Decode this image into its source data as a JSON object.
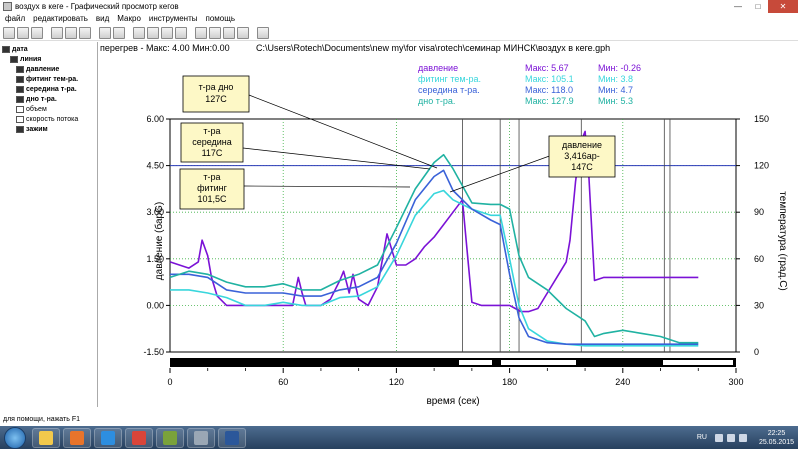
{
  "window": {
    "title": "воздух в кеге - Графический просмотр кегов"
  },
  "menu": [
    "файл",
    "редактировать",
    "вид",
    "Макро",
    "инструменты",
    "помощь"
  ],
  "tree": {
    "items": [
      {
        "label": "дата",
        "bold": true,
        "level": 0
      },
      {
        "label": "линия",
        "bold": true,
        "level": 1
      },
      {
        "label": "давление",
        "bold": true,
        "level": 2
      },
      {
        "label": "фитинг тем-ра.",
        "bold": true,
        "level": 2
      },
      {
        "label": "середина т-ра.",
        "bold": true,
        "level": 2
      },
      {
        "label": "дно т-ра.",
        "bold": true,
        "level": 2
      },
      {
        "label": "объем",
        "bold": false,
        "level": 2
      },
      {
        "label": "скорость потока",
        "bold": false,
        "level": 2
      },
      {
        "label": "зажим",
        "bold": true,
        "level": 2
      }
    ]
  },
  "header": {
    "info": "перегрев - Макс: 4.00  Мин:0.00",
    "path": "C:\\Users\\Rotech\\Documents\\new my\\for visa\\rotech\\семинар МИНСК\\воздух в кеге.gph"
  },
  "legend": [
    {
      "name": "давление",
      "max": "Макс: 5.67",
      "min": "Мин: -0.26",
      "color": "#7b12d6"
    },
    {
      "name": "фитинг тем-ра.",
      "max": "Макс: 105.1",
      "min": "Мин: 3.8",
      "color": "#38d6dc"
    },
    {
      "name": "середина т-ра.",
      "max": "Макс: 118.0",
      "min": "Мин: 4.7",
      "color": "#3a62d8"
    },
    {
      "name": "дно т-ра.",
      "max": "Макс: 127.9",
      "min": "Мин: 5.3",
      "color": "#20b2a2"
    }
  ],
  "annotations": [
    {
      "lines": [
        "т-ра дно",
        "127C"
      ]
    },
    {
      "lines": [
        "т-ра",
        "середина",
        "117C"
      ]
    },
    {
      "lines": [
        "т-ра",
        "фитинг",
        "101,5C"
      ]
    },
    {
      "lines": [
        "давление",
        "3,416ар-",
        "147C"
      ]
    }
  ],
  "chart_data": {
    "type": "line",
    "xlabel": "время (сек)",
    "ylabel": "давление (барG)",
    "y2label": "температура (град.C)",
    "xlim": [
      0,
      300
    ],
    "ylim": [
      -1.5,
      6.0
    ],
    "y2lim": [
      0,
      150
    ],
    "x_ticks": [
      0,
      60,
      120,
      180,
      240,
      300
    ],
    "y_ticks": [
      "-1.50",
      "0.00",
      "1.50",
      "3.00",
      "4.50",
      "6.00"
    ],
    "y2_ticks": [
      0,
      30,
      60,
      90,
      120,
      150
    ],
    "reference_line_y": 4.5,
    "grid": true,
    "series": [
      {
        "name": "давление",
        "axis": "left",
        "color": "#7b12d6",
        "x": [
          0,
          5,
          10,
          15,
          17,
          20,
          22,
          25,
          30,
          35,
          40,
          45,
          50,
          55,
          60,
          65,
          68,
          70,
          72,
          75,
          80,
          85,
          90,
          92,
          95,
          97,
          100,
          105,
          110,
          115,
          120,
          122,
          125,
          130,
          135,
          140,
          145,
          150,
          155,
          160,
          165,
          170,
          175,
          180,
          183,
          186,
          190,
          195,
          200,
          205,
          210,
          212,
          215,
          218,
          220,
          222,
          225,
          230,
          240,
          250,
          260,
          270,
          280
        ],
        "values": [
          1.4,
          1.3,
          1.2,
          1.4,
          2.1,
          1.6,
          0.9,
          0.3,
          0.0,
          0.0,
          0.0,
          0.0,
          0.0,
          0.0,
          0.0,
          0.0,
          0.9,
          0.4,
          0.0,
          0.0,
          0.0,
          0.2,
          0.8,
          1.1,
          0.4,
          1.0,
          0.2,
          0.0,
          0.6,
          2.3,
          1.3,
          1.3,
          1.3,
          1.5,
          1.9,
          2.2,
          2.6,
          3.0,
          3.4,
          0.1,
          0.0,
          0.0,
          0.0,
          0.0,
          -0.1,
          -0.2,
          -0.2,
          -0.1,
          0.4,
          0.9,
          1.4,
          2.1,
          4.0,
          5.3,
          5.6,
          4.2,
          0.8,
          0.9,
          0.9,
          0.9,
          0.9,
          0.9,
          0.9
        ]
      },
      {
        "name": "фитинг тем-ра.",
        "axis": "right",
        "color": "#38d6dc",
        "x": [
          0,
          10,
          20,
          30,
          40,
          50,
          60,
          70,
          80,
          90,
          100,
          110,
          120,
          130,
          140,
          145,
          150,
          160,
          170,
          175,
          180,
          185,
          190,
          200,
          210,
          220,
          230,
          240,
          250,
          260,
          270,
          280
        ],
        "values": [
          40,
          40,
          38,
          35,
          30,
          30,
          32,
          30,
          30,
          35,
          36,
          42,
          62,
          88,
          102,
          104,
          98,
          92,
          88,
          88,
          60,
          30,
          15,
          7,
          5,
          4,
          4,
          4,
          4,
          4,
          4,
          4
        ]
      },
      {
        "name": "середина т-ра.",
        "axis": "right",
        "color": "#3a62d8",
        "x": [
          0,
          10,
          20,
          30,
          40,
          50,
          60,
          70,
          80,
          90,
          100,
          110,
          120,
          130,
          140,
          145,
          150,
          160,
          170,
          175,
          180,
          185,
          190,
          200,
          210,
          220,
          230,
          240,
          250,
          260,
          270,
          280
        ],
        "values": [
          50,
          50,
          48,
          40,
          38,
          38,
          38,
          36,
          36,
          40,
          42,
          48,
          70,
          98,
          113,
          117,
          104,
          92,
          85,
          82,
          50,
          22,
          10,
          6,
          5,
          5,
          5,
          5,
          5,
          5,
          5,
          5
        ]
      },
      {
        "name": "дно т-ра.",
        "axis": "right",
        "color": "#20b2a2",
        "x": [
          0,
          10,
          20,
          30,
          40,
          50,
          60,
          70,
          80,
          90,
          100,
          110,
          120,
          130,
          140,
          145,
          150,
          160,
          170,
          175,
          180,
          185,
          190,
          200,
          210,
          220,
          225,
          230,
          240,
          250,
          260,
          270,
          280
        ],
        "values": [
          48,
          52,
          50,
          45,
          42,
          42,
          44,
          40,
          40,
          46,
          50,
          56,
          80,
          105,
          122,
          127,
          118,
          96,
          95,
          95,
          92,
          62,
          48,
          40,
          28,
          20,
          10,
          12,
          14,
          12,
          10,
          6,
          6
        ]
      }
    ]
  },
  "statusbar": {
    "text": "для помощи, нажать F1"
  },
  "tray": {
    "lang": "RU",
    "time": "22:25",
    "date": "25.05.2015"
  }
}
